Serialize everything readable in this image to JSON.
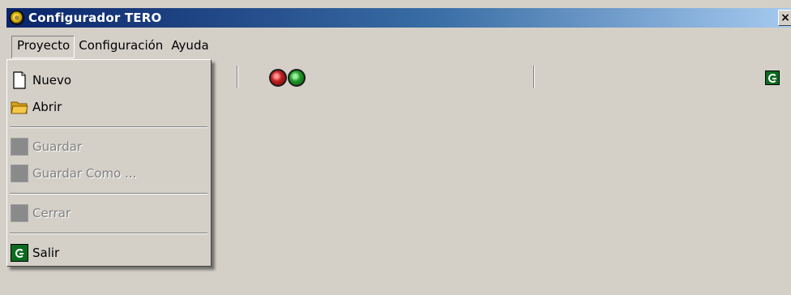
{
  "window": {
    "title": "Configurador TERO",
    "close_label": "×"
  },
  "menubar": {
    "items": [
      {
        "label": "Proyecto",
        "active": true
      },
      {
        "label": "Configuración",
        "active": false
      },
      {
        "label": "Ayuda",
        "active": false
      }
    ]
  },
  "toolbar": {
    "icons": [
      "red-light-icon",
      "green-light-icon",
      "exit-icon"
    ]
  },
  "dropdown": {
    "items": [
      {
        "label": "Nuevo",
        "icon": "new-file-icon",
        "enabled": true
      },
      {
        "label": "Abrir",
        "icon": "folder-open-icon",
        "enabled": true
      },
      {
        "label": "Guardar",
        "icon": "save-icon",
        "enabled": false
      },
      {
        "label": "Guardar Como ...",
        "icon": "save-as-icon",
        "enabled": false
      },
      {
        "label": "Cerrar",
        "icon": "close-file-icon",
        "enabled": false
      },
      {
        "label": "Salir",
        "icon": "exit-icon",
        "enabled": true
      }
    ]
  },
  "colors": {
    "title_bar_start": "#0a246a",
    "title_bar_end": "#a6caf0",
    "face": "#d4d0c8",
    "disabled_text": "#808080"
  }
}
